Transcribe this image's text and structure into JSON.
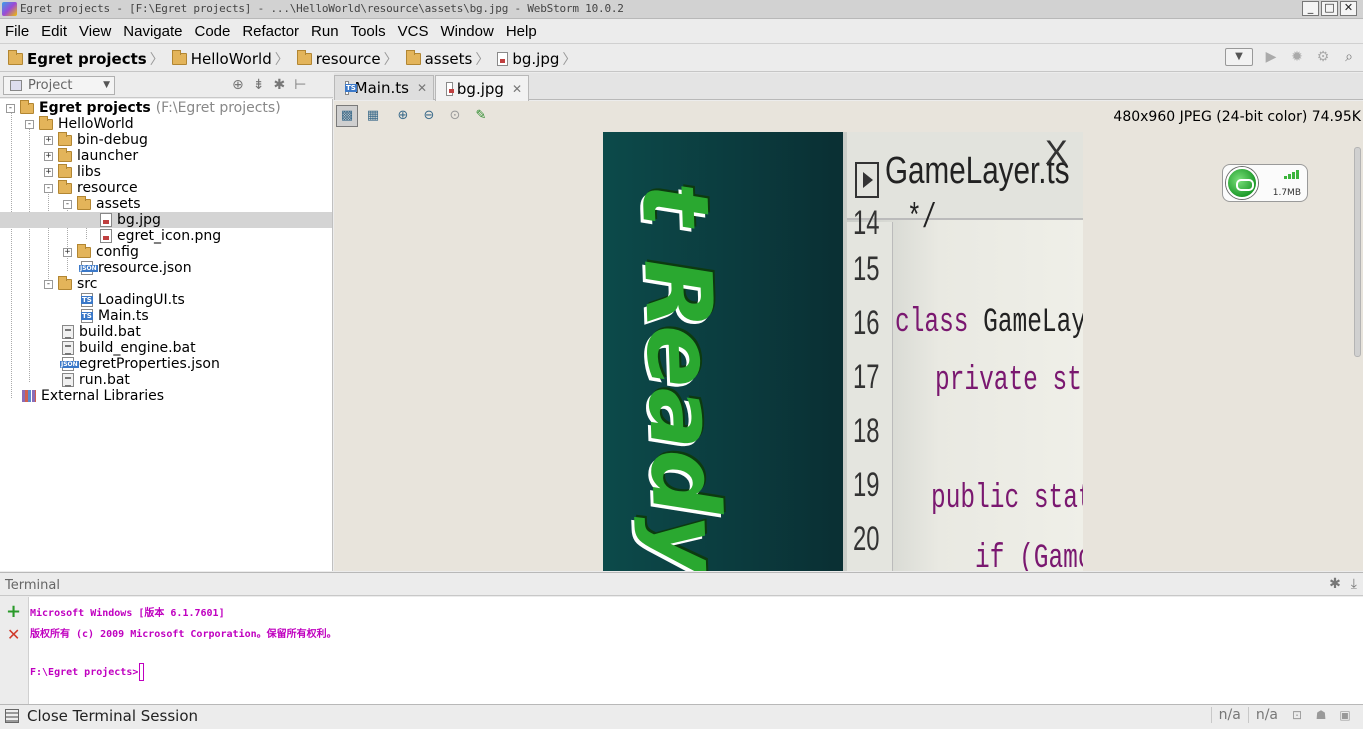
{
  "window": {
    "title": "Egret projects - [F:\\Egret projects] - ...\\HelloWorld\\resource\\assets\\bg.jpg - WebStorm 10.0.2",
    "buttons": [
      "_",
      "□",
      "✕"
    ]
  },
  "menu": [
    "File",
    "Edit",
    "View",
    "Navigate",
    "Code",
    "Refactor",
    "Run",
    "Tools",
    "VCS",
    "Window",
    "Help"
  ],
  "breadcrumb": [
    "Egret projects",
    "HelloWorld",
    "resource",
    "assets",
    "bg.jpg"
  ],
  "project_panel": {
    "view_label": "Project",
    "tree": [
      {
        "label": "Egret projects",
        "hint": "(F:\\Egret projects)",
        "icon": "folder-icon",
        "toggle": "-"
      },
      {
        "label": "HelloWorld",
        "icon": "folder-icon",
        "toggle": "-"
      },
      {
        "label": "bin-debug",
        "icon": "folder-icon",
        "toggle": "+"
      },
      {
        "label": "launcher",
        "icon": "folder-icon",
        "toggle": "+"
      },
      {
        "label": "libs",
        "icon": "folder-icon",
        "toggle": "+"
      },
      {
        "label": "resource",
        "icon": "folder-icon",
        "toggle": "-"
      },
      {
        "label": "assets",
        "icon": "folder-icon",
        "toggle": "-"
      },
      {
        "label": "bg.jpg",
        "icon": "image-file-icon",
        "selected": true
      },
      {
        "label": "egret_icon.png",
        "icon": "image-file-icon"
      },
      {
        "label": "config",
        "icon": "folder-icon",
        "toggle": "+"
      },
      {
        "label": "resource.json",
        "icon": "json-file-icon"
      },
      {
        "label": "src",
        "icon": "folder-icon",
        "toggle": "-"
      },
      {
        "label": "LoadingUI.ts",
        "icon": "ts-file-icon"
      },
      {
        "label": "Main.ts",
        "icon": "ts-file-icon"
      },
      {
        "label": "build.bat",
        "icon": "bat-file-icon"
      },
      {
        "label": "build_engine.bat",
        "icon": "bat-file-icon"
      },
      {
        "label": "egretProperties.json",
        "icon": "json-file-icon"
      },
      {
        "label": "run.bat",
        "icon": "bat-file-icon"
      },
      {
        "label": "External Libraries",
        "icon": "library-icon"
      }
    ]
  },
  "editor_tabs": [
    {
      "label": "Main.ts",
      "icon": "ts-file-icon",
      "active": false
    },
    {
      "label": "bg.jpg",
      "icon": "image-file-icon",
      "active": true
    }
  ],
  "image_viewer": {
    "info": "480x960 JPEG (24-bit color) 74.95K",
    "photo_text": {
      "ready": "t Ready!",
      "tab_name": "GameLayer.ts",
      "tab_close": "X",
      "line_numbers": [
        "14",
        "15",
        "16",
        "17",
        "18",
        "19",
        "20"
      ],
      "code": {
        "line14": "*/",
        "line16_kw": "class",
        "line16_name": "GameLayer",
        "line17": "private stat",
        "line19": "public stati",
        "line20": "if (Gamo"
      }
    }
  },
  "memory_widget": {
    "value": "1.7MB"
  },
  "terminal": {
    "title": "Terminal",
    "lines": [
      "Microsoft Windows [版本 6.1.7601]",
      "版权所有 (c) 2009 Microsoft Corporation。保留所有权利。",
      "",
      "F:\\Egret projects>"
    ]
  },
  "statusbar": {
    "message": "Close Terminal Session",
    "fields": [
      "n/a",
      "n/a"
    ]
  }
}
